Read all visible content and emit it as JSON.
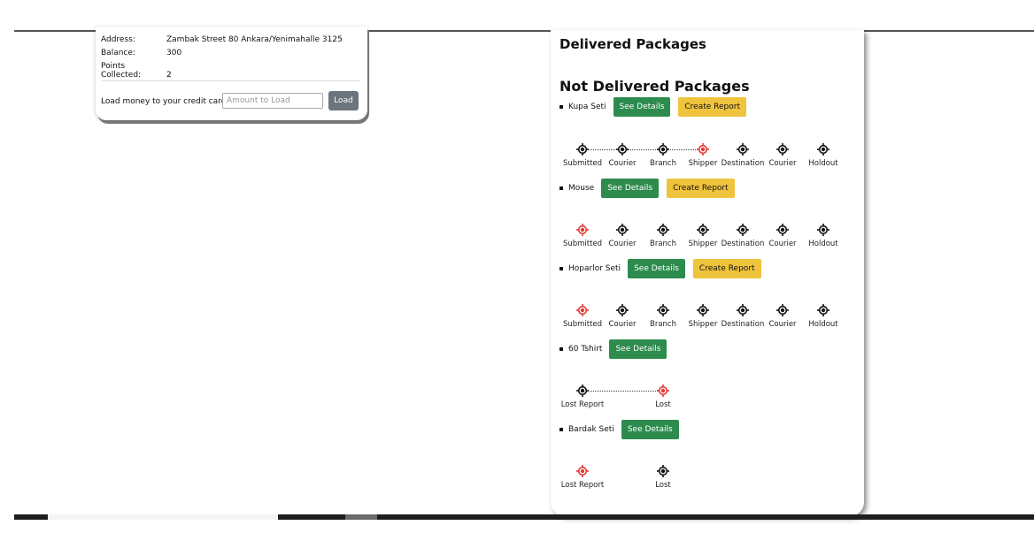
{
  "profile": {
    "rows": [
      {
        "label": "Address:",
        "value": "Zambak Street 80 Ankara/Yenimahalle 3125"
      },
      {
        "label": "Balance:",
        "value": "300"
      },
      {
        "label": "Points Collected:",
        "value": "2"
      }
    ],
    "load_label": "Load money to your credit card:",
    "amount_placeholder": "Amount to Load",
    "load_button": "Load"
  },
  "packages": {
    "delivered_title": "Delivered Packages",
    "not_delivered_title": "Not Delivered Packages",
    "items": [
      {
        "name": "Kupa Seti",
        "details_label": "See Details",
        "report_label": "Create Report",
        "tracker": {
          "stages": [
            "Submitted",
            "Courier",
            "Branch",
            "Shipper",
            "Destination",
            "Courier",
            "Holdout"
          ],
          "active_index": 3,
          "connected_until": 3
        }
      },
      {
        "name": "Mouse",
        "details_label": "See Details",
        "report_label": "Create Report",
        "tracker": {
          "stages": [
            "Submitted",
            "Courier",
            "Branch",
            "Shipper",
            "Destination",
            "Courier",
            "Holdout"
          ],
          "active_index": 0,
          "connected_until": 0
        }
      },
      {
        "name": "Hoparlor Seti",
        "details_label": "See Details",
        "report_label": "Create Report",
        "tracker": {
          "stages": [
            "Submitted",
            "Courier",
            "Branch",
            "Shipper",
            "Destination",
            "Courier",
            "Holdout"
          ],
          "active_index": 0,
          "connected_until": 0
        }
      },
      {
        "name": "60 Tshirt",
        "details_label": "See Details",
        "tracker": {
          "stages": [
            "Lost Report",
            "Lost"
          ],
          "active_index": 1,
          "connected_until": 1
        }
      },
      {
        "name": "Bardak Seti",
        "details_label": "See Details",
        "tracker": {
          "stages": [
            "Lost Report",
            "Lost"
          ],
          "active_index": 0,
          "connected_until": 0
        }
      }
    ]
  },
  "colors": {
    "active_node": "#e53935",
    "inactive_node": "#111111",
    "details_button": "#2d8b4e",
    "report_button": "#f0c33c",
    "load_button": "#6c757d"
  }
}
